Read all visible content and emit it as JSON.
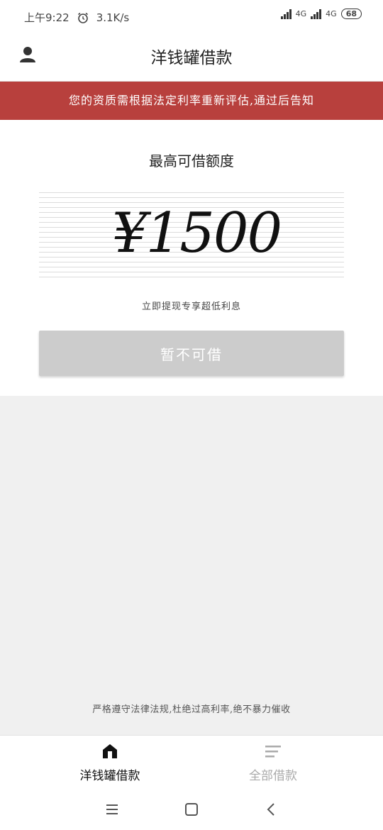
{
  "status_bar": {
    "time": "上午9:22",
    "speed": "3.1K/s",
    "net1": "4G",
    "net2": "4G",
    "battery": "68"
  },
  "header": {
    "title": "洋钱罐借款",
    "user_icon": "user-icon"
  },
  "banner": {
    "text": "您的资质需根据法定利率重新评估,通过后告知",
    "color": "#b8403d"
  },
  "card": {
    "caption": "最高可借额度",
    "amount": "¥1500",
    "subtitle": "立即提现专享超低利息",
    "button_label": "暂不可借"
  },
  "footer_note": "严格遵守法律法规,杜绝过高利率,绝不暴力催收",
  "tabs": [
    {
      "label": "洋钱罐借款",
      "icon": "home-icon",
      "active": true
    },
    {
      "label": "全部借款",
      "icon": "list-icon",
      "active": false
    }
  ],
  "system_nav": {
    "menu_icon": "menu-icon",
    "home_icon": "square-home-icon",
    "back_icon": "back-icon"
  }
}
